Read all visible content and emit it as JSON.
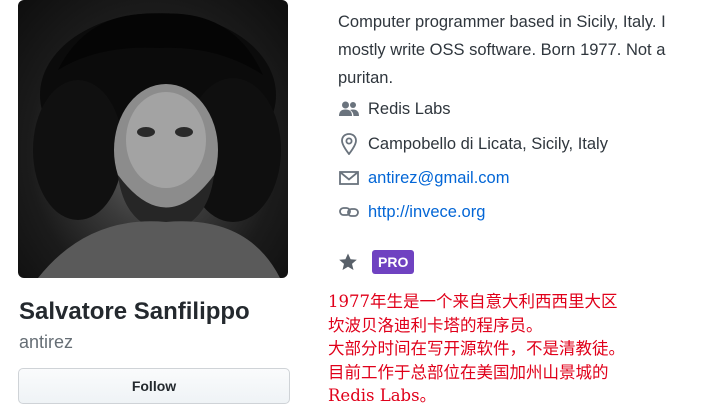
{
  "profile": {
    "avatar_icon": "profile-photo",
    "name": "Salvatore Sanfilippo",
    "username": "antirez",
    "follow_label": "Follow"
  },
  "bio": "Computer programmer based in Sicily, Italy. I mostly write OSS software. Born 1977. Not a puritan.",
  "details": {
    "organization": "Redis Labs",
    "location": "Campobello di Licata, Sicily, Italy",
    "email": "antirez@gmail.com",
    "website": "http://invece.org"
  },
  "badges": {
    "star_icon": "star-icon",
    "pro_label": "PRO",
    "pro_color": "#6f42c1"
  },
  "annotation": {
    "color": "#e0001a",
    "lines": [
      "1977年生是一个来自意大利西西里大区",
      "坎波贝洛迪利卡塔的程序员。",
      "大部分时间在写开源软件，不是清教徒。",
      "目前工作于总部位在美国加州山景城的",
      "Redis Labs。"
    ]
  },
  "colors": {
    "link": "#0366d6",
    "text": "#2f363d",
    "muted": "#666e75"
  }
}
